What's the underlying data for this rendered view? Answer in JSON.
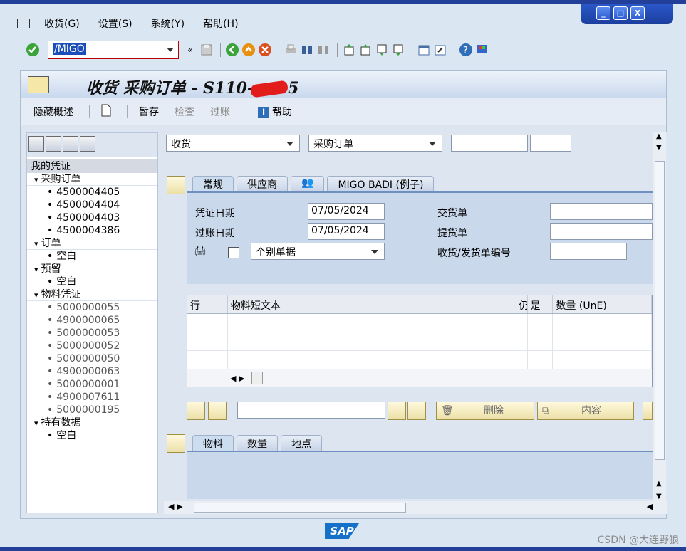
{
  "window": {
    "buttons": [
      "_",
      "□",
      "X"
    ]
  },
  "menubar": {
    "items": [
      "收货(G)",
      "设置(S)",
      "系统(Y)",
      "帮助(H)"
    ]
  },
  "toolbar": {
    "command_value": "/MIGO"
  },
  "app": {
    "title": "收货 采购订单 - S110-",
    "title_tail": "5",
    "toolbar": {
      "hide_overview": "隐藏概述",
      "save": "暂存",
      "check": "检查",
      "post": "过账",
      "help": "帮助"
    }
  },
  "tree": {
    "header": "我的凭证",
    "groups": [
      {
        "label": "采购订单",
        "items": [
          "4500004405",
          "4500004404",
          "4500004403",
          "4500004386"
        ]
      },
      {
        "label": "订单",
        "items": [
          "空白"
        ]
      },
      {
        "label": "预留",
        "items": [
          "空白"
        ]
      },
      {
        "label": "物料凭证",
        "items": [
          "5000000055",
          "4900000065",
          "5000000053",
          "5000000052",
          "5000000050",
          "4900000063",
          "5000000001",
          "4900007611",
          "5000000195"
        ]
      },
      {
        "label": "持有数据",
        "items": [
          "空白"
        ]
      }
    ]
  },
  "main": {
    "action_select": "收货",
    "ref_select": "采购订单",
    "header_tabs": [
      "常规",
      "供应商",
      "",
      "MIGO BADI (例子)"
    ],
    "doc_date_label": "凭证日期",
    "doc_date": "07/05/2024",
    "post_date_label": "过账日期",
    "post_date": "07/05/2024",
    "slip_select": "个别单据",
    "delivery_note_label": "交货单",
    "bill_of_lading_label": "提货单",
    "gr_slip_label": "收货/发货单编号",
    "grid_columns": [
      "行",
      "物料短文本",
      "仍",
      "是",
      "数量 (UnE)"
    ],
    "delete_label": "删除",
    "content_label": "内容",
    "detail_tabs": [
      "物料",
      "数量",
      "地点"
    ]
  },
  "footer": {
    "logo": "SAP",
    "watermark": "CSDN @大连野狼"
  }
}
